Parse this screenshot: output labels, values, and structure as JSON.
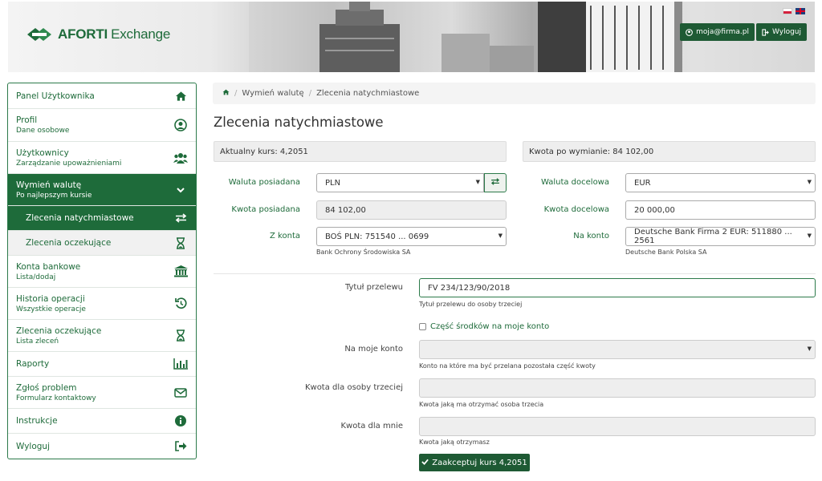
{
  "header": {
    "logo_brand": "AFORTI",
    "logo_sub": "Exchange",
    "email_button": "moja@firma.pl",
    "logout_button": "Wyloguj",
    "flags": [
      "flag-pl",
      "flag-en"
    ]
  },
  "sidebar": {
    "items": [
      {
        "title": "Panel Użytkownika",
        "subtitle": "",
        "icon": "home-icon"
      },
      {
        "title": "Profil",
        "subtitle": "Dane osobowe",
        "icon": "user-icon"
      },
      {
        "title": "Użytkownicy",
        "subtitle": "Zarządzanie upoważnieniami",
        "icon": "users-icon"
      },
      {
        "title": "Wymień walutę",
        "subtitle": "Po najlepszym kursie",
        "icon": "chevron-down-icon"
      },
      {
        "title": "Zlecenia natychmiastowe",
        "subtitle": "",
        "icon": "exchange-icon"
      },
      {
        "title": "Zlecenia oczekujące",
        "subtitle": "",
        "icon": "hourglass-icon"
      },
      {
        "title": "Konta bankowe",
        "subtitle": "Lista/dodaj",
        "icon": "bank-icon"
      },
      {
        "title": "Historia operacji",
        "subtitle": "Wszystkie operacje",
        "icon": "history-icon"
      },
      {
        "title": "Zlecenia oczekujące",
        "subtitle": "Lista zleceń",
        "icon": "hourglass-icon"
      },
      {
        "title": "Raporty",
        "subtitle": "",
        "icon": "bar-chart-icon"
      },
      {
        "title": "Zgłoś problem",
        "subtitle": "Formularz kontaktowy",
        "icon": "envelope-icon"
      },
      {
        "title": "Instrukcje",
        "subtitle": "",
        "icon": "info-icon"
      },
      {
        "title": "Wyloguj",
        "subtitle": "",
        "icon": "sign-out-icon"
      }
    ]
  },
  "breadcrumb": {
    "home_icon": "home-icon",
    "items": [
      "Wymień walutę",
      "Zlecenia natychmiastowe"
    ]
  },
  "page": {
    "title": "Zlecenia natychmiastowe",
    "current_rate": "Aktualny kurs: 4,2051",
    "amount_after": "Kwota po wymianie: 84 102,00"
  },
  "form": {
    "currency_owned_label": "Waluta posiadana",
    "currency_owned_value": "PLN",
    "currency_target_label": "Waluta docelowa",
    "currency_target_value": "EUR",
    "amount_owned_label": "Kwota posiadana",
    "amount_owned_value": "84 102,00",
    "amount_target_label": "Kwota docelowa",
    "amount_target_value": "20 000,00",
    "from_account_label": "Z konta",
    "from_account_value": "BOŚ PLN: 751540 ... 0699",
    "from_account_bank": "Bank Ochrony Środowiska SA",
    "to_account_label": "Na konto",
    "to_account_value": "Deutsche Bank Firma 2 EUR: 511880 ... 2561",
    "to_account_bank": "Deutsche Bank Polska SA",
    "transfer_title_label": "Tytuł przelewu",
    "transfer_title_value": "FV 234/123/90/2018",
    "transfer_title_help": "Tytuł przelewu do osoby trzeciej",
    "partial_checkbox_label": "Część środków na moje konto",
    "my_account_label": "Na moje konto",
    "my_account_help": "Konto na które ma być przelana pozostała część kwoty",
    "third_party_amount_label": "Kwota dla osoby trzeciej",
    "third_party_amount_help": "Kwota jaką ma otrzymać osoba trzecia",
    "my_amount_label": "Kwota dla mnie",
    "my_amount_help": "Kwota jaką otrzymasz",
    "accept_button": "Zaakceptuj kurs 4,2051"
  },
  "colors": {
    "brand_green": "#1e6b3a",
    "dark_green": "#1e5a34"
  }
}
